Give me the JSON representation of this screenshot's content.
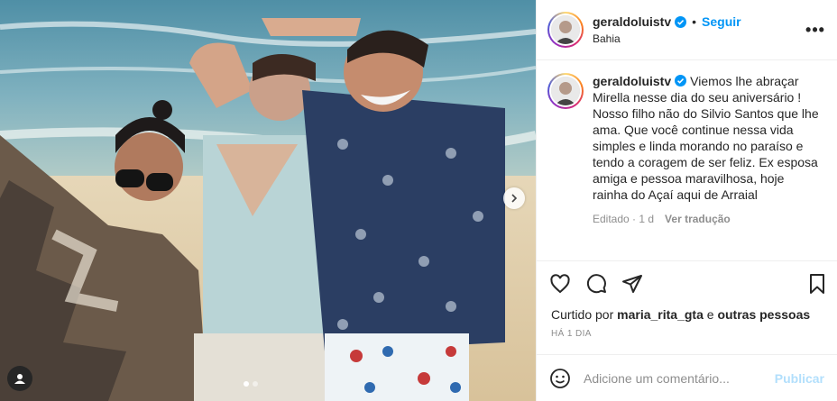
{
  "post": {
    "username": "geraldoluistv",
    "follow_label": "Seguir",
    "separator": "•",
    "location": "Bahia",
    "more_label": "•••",
    "caption": "Viemos lhe abraçar Mirella nesse dia do seu aniversário ! Nosso filho não do Silvio Santos que lhe ama. Que você continue nessa vida simples e linda morando no paraíso e tendo a coragem de ser feliz. Ex esposa amiga e pessoa maravilhosa, hoje rainha do Açaí aqui de Arraial",
    "edited_label": "Editado · 1 d",
    "translate_label": "Ver tradução",
    "liked_prefix": "Curtido por",
    "liked_user": "maria_rita_gta",
    "liked_conj": "e",
    "liked_others": "outras pessoas",
    "time_ago": "HÁ 1 DIA",
    "comment_placeholder": "Adicione um comentário...",
    "publish_label": "Publicar"
  },
  "carousel": {
    "dots": 2,
    "active_index": 0
  },
  "icons": {
    "verified": "verified-badge-icon",
    "like": "heart-icon",
    "comment": "comment-icon",
    "share": "paper-plane-icon",
    "save": "bookmark-icon",
    "emoji": "emoji-icon",
    "tag": "user-tag-icon",
    "next": "chevron-right-icon"
  },
  "colors": {
    "accent": "#0095f6",
    "publish_disabled": "#b2dffc",
    "muted": "#8e8e8e"
  }
}
